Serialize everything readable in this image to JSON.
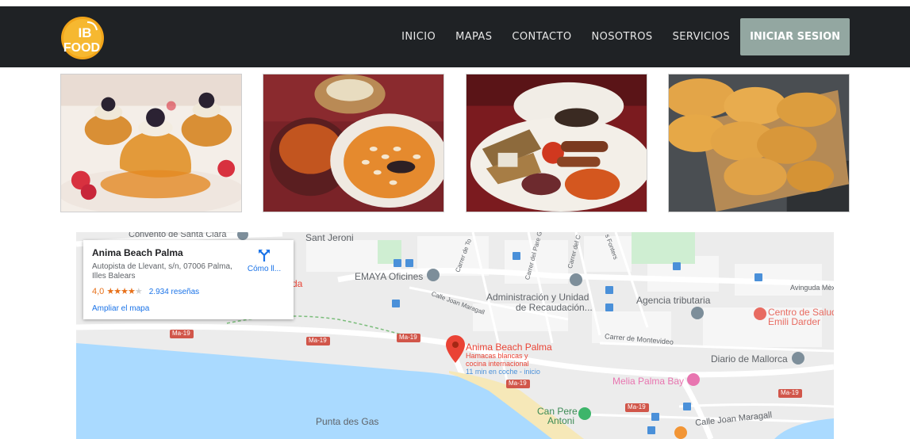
{
  "brand": {
    "logo_text_top": "IB",
    "logo_text_bottom": "FOOD"
  },
  "nav": {
    "items": [
      "INICIO",
      "MAPAS",
      "CONTACTO",
      "NOSOTROS",
      "SERVICIOS"
    ],
    "login_label": "INICIAR SESION"
  },
  "gallery": {
    "photos": [
      "flan-dessert-icon",
      "fabada-stew-icon",
      "full-breakfast-icon",
      "empanadas-icon"
    ]
  },
  "map": {
    "card": {
      "name": "Anima Beach Palma",
      "address": "Autopista de Llevant, s/n, 07006 Palma, Illes Balears",
      "rating": "4,0",
      "stars": "★★★★",
      "stars_off": "★",
      "reviews": "2.934 reseñas",
      "enlarge": "Ampliar el mapa",
      "directions": "Cómo ll..."
    },
    "labels": {
      "convento": "Convento de Santa Clara",
      "sant_jeroni": "Sant Jeroni",
      "emaya": "EMAYA Oficines",
      "admin_1": "Administración y Unidad",
      "admin_2": "de Recaudación...",
      "agencia": "Agencia tributaria",
      "centro_1": "Centro de Salud",
      "centro_2": "Emili Darder",
      "avinguda": "Avinguda Mèx",
      "carrer_montevideo": "Carrer de Montevideo",
      "diario": "Diario de Mallorca",
      "anima_pin": "Anima Beach Palma",
      "anima_sub1": "Hamacas blancas y",
      "anima_sub2": "cocina internacional",
      "anima_time": "11 min en coche - inicio",
      "melia": "Melia Palma Bay",
      "can_pere_1": "Can Pere",
      "can_pere_2": "Antoni",
      "calle_maragall": "Calle Joan Maragall",
      "calle_joan_diag": "Calle Joan Maragall",
      "punta": "Punta des Gas",
      "ma19_a": "Ma-19",
      "ma19_b": "Ma-19",
      "ma19_c": "Ma-19",
      "ma19_d": "Ma-19",
      "ma19_e": "Ma-19",
      "ma19_f": "Ma-19",
      "carrer_de_to": "Carrer de To",
      "carrer_pare": "Carrer del Pare G",
      "carrer_de": "Carrer del C",
      "fonters": "s Fonters",
      "frag_da": "da"
    }
  },
  "colors": {
    "navbar": "#1f2225",
    "login_button": "#93a7a1",
    "sea": "#aadaff",
    "pin": "#ea4335",
    "road_badge": "#d1564a"
  }
}
